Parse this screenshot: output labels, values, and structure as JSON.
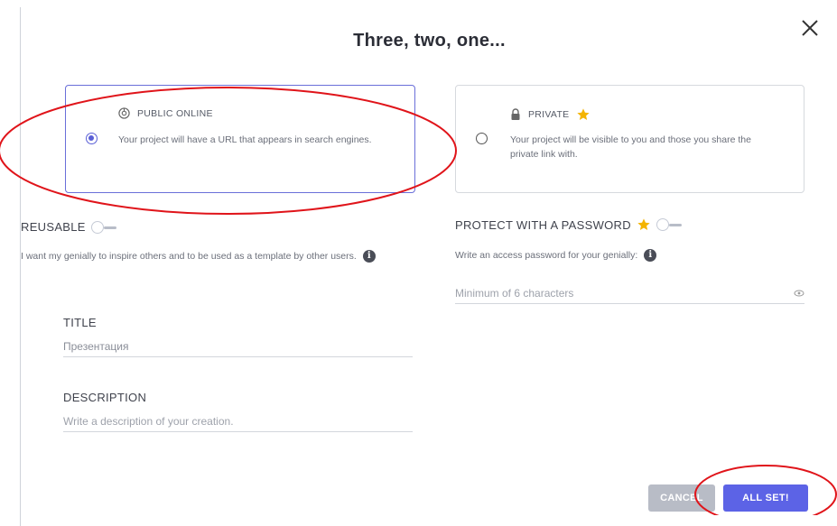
{
  "background": {
    "title": ""
  },
  "modal": {
    "title": "Three, two, one...",
    "close_glyph": "×"
  },
  "options": {
    "public": {
      "label": "PUBLIC ONLINE",
      "description": "Your project will have a URL that appears in search engines.",
      "icon": "globe-icon",
      "selected": true
    },
    "private": {
      "label": "PRIVATE",
      "description": "Your project will be visible to you and those you share the private link with.",
      "icon": "lock-icon",
      "premium": true,
      "selected": false
    }
  },
  "reusable": {
    "label": "REUSABLE",
    "help": "I want my genially to inspire others and to be used as a template by other users.",
    "enabled": false
  },
  "password": {
    "label": "PROTECT WITH A PASSWORD",
    "help": "Write an access password for your genially:",
    "placeholder": "Minimum of 6 characters",
    "premium": true,
    "enabled": false
  },
  "title_field": {
    "label": "TITLE",
    "value": "Презентация"
  },
  "description_field": {
    "label": "DESCRIPTION",
    "placeholder": "Write a description of your creation."
  },
  "buttons": {
    "cancel": "CANCEL",
    "all_set": "ALL SET!"
  },
  "colors": {
    "accent": "#5c63e6",
    "star": "#f4b400",
    "annotation": "#e0141a"
  }
}
